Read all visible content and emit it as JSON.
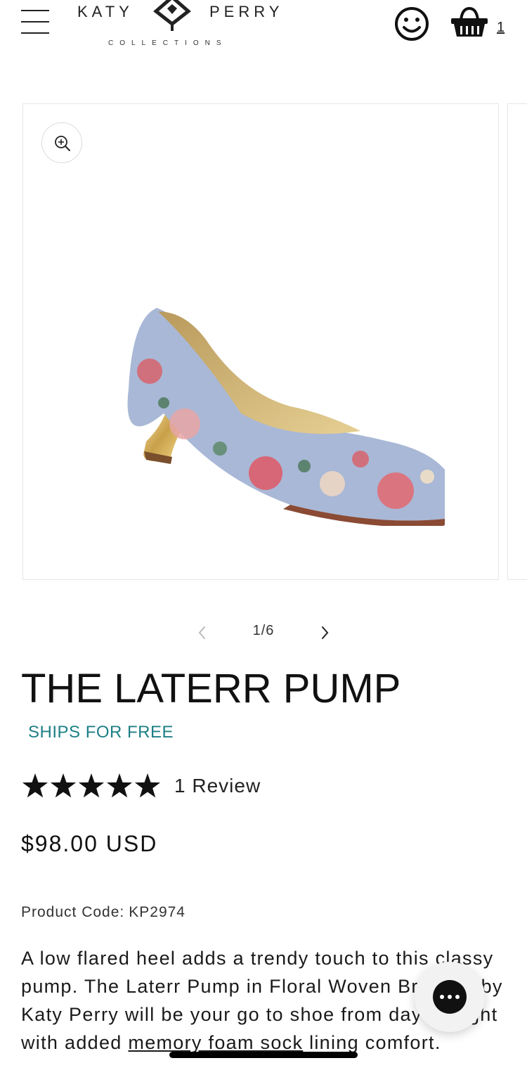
{
  "header": {
    "menu_icon": "hamburger-menu-icon",
    "logo": {
      "left": "KATY",
      "right": "PERRY",
      "sub": "COLLECTIONS"
    },
    "account_icon": "smiley-account-icon",
    "cart_icon": "basket-cart-icon",
    "cart_count": "1"
  },
  "gallery": {
    "zoom_icon": "zoom-in-icon",
    "current": 1,
    "total": 6,
    "counter_text": "1/6",
    "prev_icon": "chevron-left-icon",
    "next_icon": "chevron-right-icon"
  },
  "product": {
    "title": "THE LATERR PUMP",
    "shipping": "SHIPS FOR FREE",
    "rating": 5,
    "rating_max": 5,
    "review_count": "1 Review",
    "price": "$98.00 USD",
    "code_label": "Product Code:",
    "code_value": "KP2974",
    "description_part1": "A low flared heel adds a trendy touch to this classy pump. The Laterr Pump in Floral Woven Brocade by Katy Perry will be your go to shoe from day to night with added ",
    "description_link": "memory foam sock",
    "description_part2": " lining comfort."
  },
  "chat": {
    "icon": "chat-bubble-icon"
  },
  "colors": {
    "accent": "#1e7f86",
    "text": "#111111",
    "border": "#e6e6e6"
  }
}
